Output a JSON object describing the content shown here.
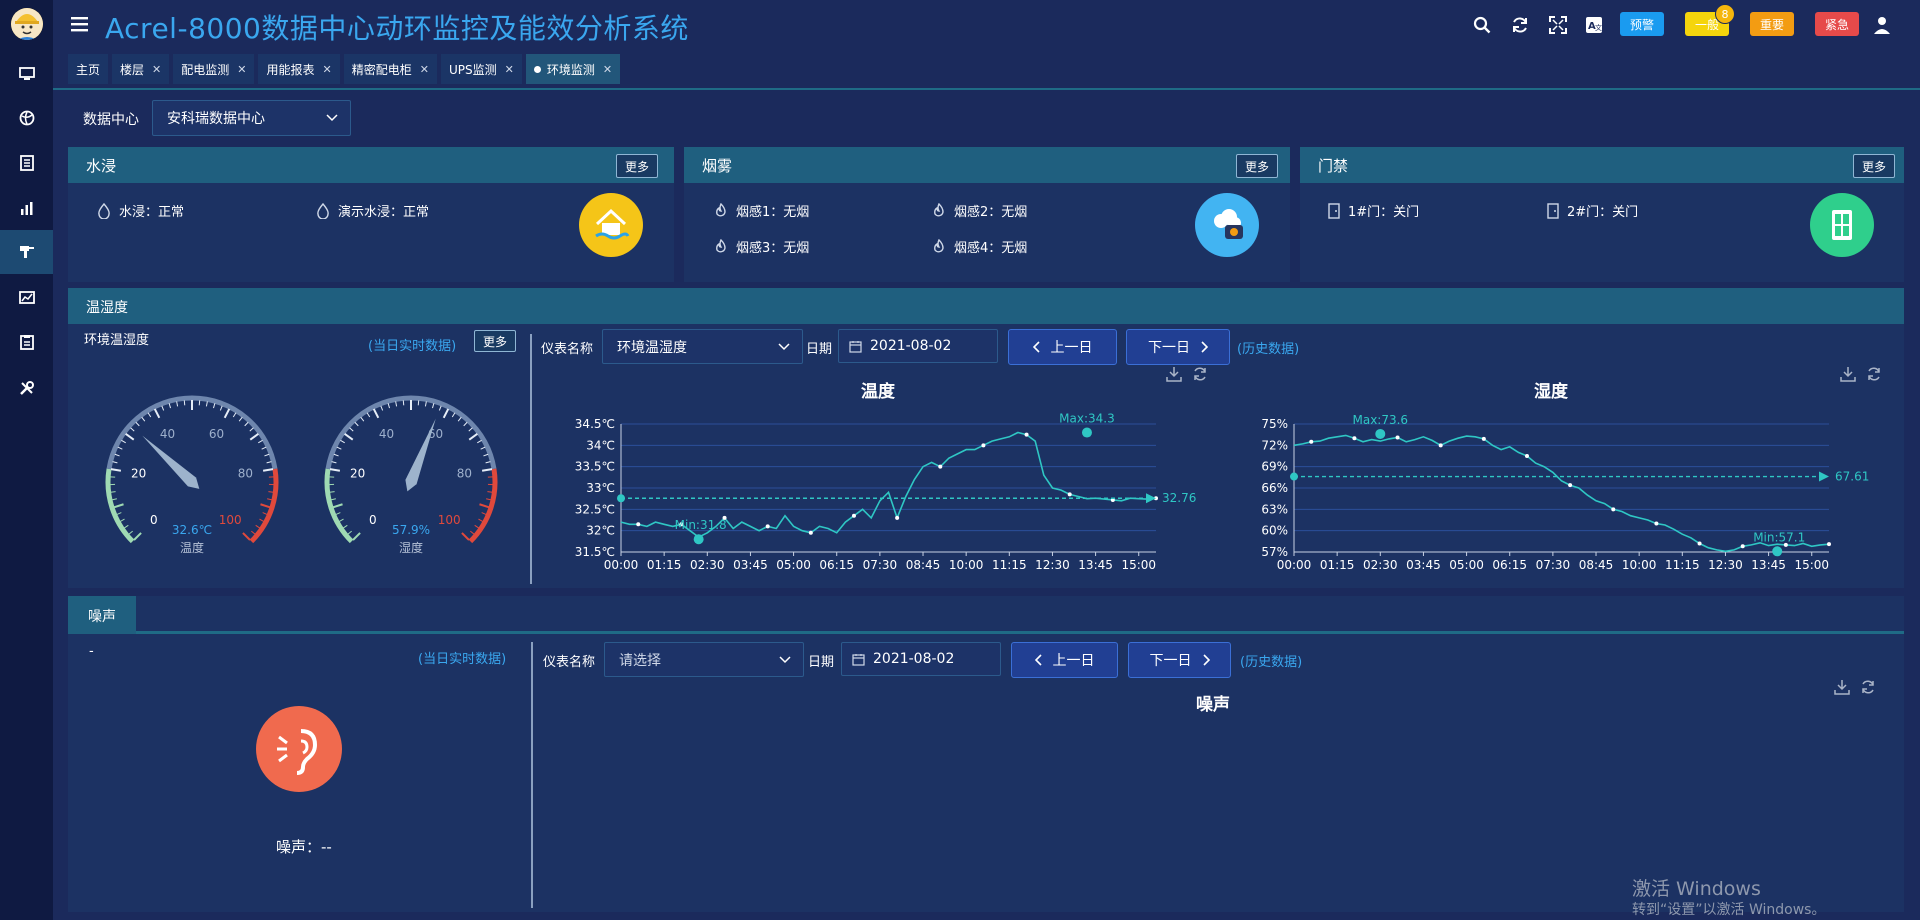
{
  "app": {
    "title": "Acrel-8000数据中心动环监控及能效分析系统"
  },
  "header": {
    "levels": [
      {
        "label": "预警",
        "color": "#1a9bf0"
      },
      {
        "label": "一般",
        "color": "#f5d50c",
        "badge": "8"
      },
      {
        "label": "重要",
        "color": "#f39c12"
      },
      {
        "label": "紧急",
        "color": "#e64a4a"
      }
    ]
  },
  "tabs": [
    {
      "label": "主页",
      "closable": false
    },
    {
      "label": "楼层",
      "closable": true
    },
    {
      "label": "配电监测",
      "closable": true
    },
    {
      "label": "用能报表",
      "closable": true
    },
    {
      "label": "精密配电柜",
      "closable": true
    },
    {
      "label": "UPS监测",
      "closable": true
    },
    {
      "label": "环境监测",
      "closable": true,
      "active": true
    }
  ],
  "filter": {
    "label": "数据中心",
    "value": "安科瑞数据中心"
  },
  "more_label": "更多",
  "water": {
    "title": "水浸",
    "sensors": [
      {
        "label": "水浸：正常"
      },
      {
        "label": "演示水浸：正常"
      }
    ]
  },
  "smoke": {
    "title": "烟雾",
    "sensors": [
      {
        "label": "烟感1：无烟"
      },
      {
        "label": "烟感2：无烟"
      },
      {
        "label": "烟感3：无烟"
      },
      {
        "label": "烟感4：无烟"
      }
    ]
  },
  "door": {
    "title": "门禁",
    "sensors": [
      {
        "label": "1#门：关门"
      },
      {
        "label": "2#门：关门"
      }
    ]
  },
  "th": {
    "title": "温湿度",
    "sub_title": "环境温湿度",
    "realtime": "(当日实时数据)",
    "gauges": [
      {
        "label": "温度",
        "value": 32.6,
        "value_text": "32.6℃"
      },
      {
        "label": "湿度",
        "value": 57.9,
        "value_text": "57.9%"
      }
    ],
    "gauge_ticks": [
      "0",
      "20",
      "40",
      "60",
      "80",
      "100"
    ],
    "meter_label": "仪表名称",
    "meter_value": "环境温湿度",
    "date_label": "日期",
    "date_value": "2021-08-02",
    "prev": "上一日",
    "next": "下一日",
    "history": "(历史数据)"
  },
  "noise": {
    "title": "噪声",
    "dash": "-",
    "realtime": "(当日实时数据)",
    "reading": "噪声：--",
    "meter_label": "仪表名称",
    "meter_placeholder": "请选择",
    "date_label": "日期",
    "date_value": "2021-08-02",
    "prev": "上一日",
    "next": "下一日",
    "history": "(历史数据)",
    "chart_title": "噪声"
  },
  "watermark": {
    "line1": "激活 Windows",
    "line2": "转到“设置”以激活 Windows。"
  },
  "chart_data": [
    {
      "type": "line",
      "title": "温度",
      "x_ticks": [
        "00:00",
        "01:15",
        "02:30",
        "03:45",
        "05:00",
        "06:15",
        "07:30",
        "08:45",
        "10:00",
        "11:15",
        "12:30",
        "13:45",
        "15:00"
      ],
      "y_ticks": [
        "31.5℃",
        "32℃",
        "32.5℃",
        "33℃",
        "33.5℃",
        "34℃",
        "34.5℃"
      ],
      "ylim": [
        31.5,
        34.5
      ],
      "x_minutes_range": [
        0,
        930
      ],
      "series": [
        {
          "x_minutes": [
            0,
            15,
            30,
            45,
            60,
            75,
            90,
            105,
            120,
            135,
            150,
            165,
            180,
            195,
            210,
            225,
            240,
            255,
            270,
            285,
            300,
            315,
            330,
            345,
            360,
            375,
            390,
            405,
            420,
            435,
            450,
            465,
            480,
            495,
            510,
            525,
            540,
            555,
            570,
            585,
            600,
            615,
            630,
            645,
            660,
            675,
            690,
            705,
            720,
            735,
            750,
            765,
            780,
            795,
            810,
            825,
            840,
            855,
            870,
            885,
            900,
            915,
            930
          ],
          "values": [
            32.2,
            32.15,
            32.15,
            32.1,
            32.2,
            32.15,
            32.1,
            32.15,
            32.0,
            31.85,
            31.95,
            32.1,
            32.3,
            32.05,
            32.2,
            32.1,
            32.0,
            32.1,
            32.05,
            32.35,
            32.1,
            32.0,
            31.95,
            32.1,
            32.05,
            31.95,
            32.2,
            32.35,
            32.5,
            32.3,
            32.7,
            32.9,
            32.3,
            32.8,
            33.2,
            33.5,
            33.6,
            33.5,
            33.7,
            33.8,
            33.9,
            33.9,
            34.0,
            34.1,
            34.15,
            34.2,
            34.3,
            34.25,
            34.1,
            33.3,
            33.0,
            32.95,
            32.85,
            32.8,
            32.75,
            32.76,
            32.74,
            32.72,
            32.7,
            32.76,
            32.75,
            32.74,
            32.76
          ]
        }
      ],
      "max": {
        "label": "Max:34.3",
        "x_minutes": 810,
        "value": 34.3
      },
      "min": {
        "label": "Min:31.8",
        "x_minutes": 135,
        "value": 31.8
      },
      "mean": {
        "label": "32.76",
        "value": 32.76
      }
    },
    {
      "type": "line",
      "title": "湿度",
      "x_ticks": [
        "00:00",
        "01:15",
        "02:30",
        "03:45",
        "05:00",
        "06:15",
        "07:30",
        "08:45",
        "10:00",
        "11:15",
        "12:30",
        "13:45",
        "15:00"
      ],
      "y_ticks": [
        "57%",
        "60%",
        "63%",
        "66%",
        "69%",
        "72%",
        "75%"
      ],
      "ylim": [
        57,
        75
      ],
      "x_minutes_range": [
        0,
        930
      ],
      "series": [
        {
          "x_minutes": [
            0,
            15,
            30,
            45,
            60,
            75,
            90,
            105,
            120,
            135,
            150,
            165,
            180,
            195,
            210,
            225,
            240,
            255,
            270,
            285,
            300,
            315,
            330,
            345,
            360,
            375,
            390,
            405,
            420,
            435,
            450,
            465,
            480,
            495,
            510,
            525,
            540,
            555,
            570,
            585,
            600,
            615,
            630,
            645,
            660,
            675,
            690,
            705,
            720,
            735,
            750,
            765,
            780,
            795,
            810,
            825,
            840,
            855,
            870,
            885,
            900,
            915,
            930
          ],
          "values": [
            72.0,
            72.2,
            72.5,
            72.6,
            73.0,
            73.2,
            73.4,
            73.0,
            72.5,
            72.8,
            72.6,
            72.9,
            73.1,
            72.5,
            72.8,
            73.2,
            72.7,
            72.0,
            72.6,
            73.0,
            73.3,
            73.2,
            72.9,
            72.0,
            71.4,
            71.8,
            71.0,
            70.5,
            69.5,
            69.0,
            68.2,
            67.0,
            66.4,
            66.0,
            65.0,
            64.2,
            63.8,
            63.0,
            62.7,
            62.1,
            61.8,
            61.5,
            61.0,
            60.8,
            60.2,
            59.5,
            59.0,
            58.2,
            57.6,
            57.3,
            57.1,
            57.3,
            57.8,
            58.0,
            58.3,
            57.9,
            58.1,
            58.0,
            57.9,
            58.2,
            57.8,
            58.0,
            58.1
          ]
        }
      ],
      "max": {
        "label": "Max:73.6",
        "x_minutes": 150,
        "value": 73.6
      },
      "min": {
        "label": "Min:57.1",
        "x_minutes": 840,
        "value": 57.1
      },
      "mean": {
        "label": "67.61",
        "value": 67.61
      }
    }
  ]
}
